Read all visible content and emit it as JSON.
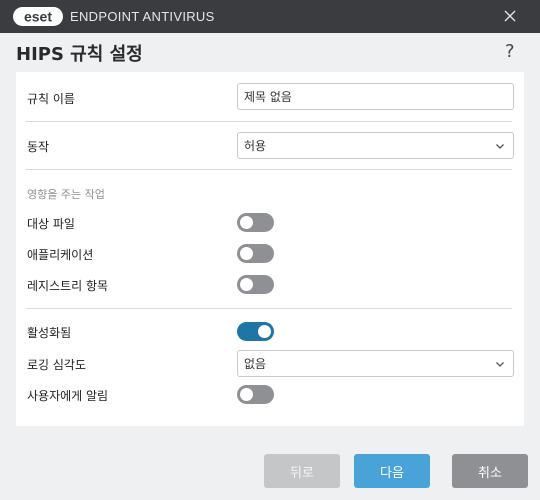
{
  "window": {
    "brand": "eset",
    "product": "ENDPOINT ANTIVIRUS"
  },
  "header": {
    "title": "HIPS 규칙 설정",
    "help": "?"
  },
  "form": {
    "rule_name_label": "규칙 이름",
    "rule_name_value": "제목 없음",
    "action_label": "동작",
    "action_value": "허용",
    "section_label": "영향을 주는 작업",
    "target_files_label": "대상 파일",
    "target_files_on": false,
    "applications_label": "애플리케이션",
    "applications_on": false,
    "registry_label": "레지스트리 항목",
    "registry_on": false,
    "enabled_label": "활성화됨",
    "enabled_on": true,
    "logging_label": "로깅 심각도",
    "logging_value": "없음",
    "notify_label": "사용자에게 알림",
    "notify_on": false
  },
  "buttons": {
    "back": "뒤로",
    "next": "다음",
    "cancel": "취소"
  },
  "colors": {
    "accent": "#1e76a6",
    "primary_button": "#4aa3d8",
    "toggle_off": "#8e9094",
    "titlebar": "#3a3c40"
  }
}
